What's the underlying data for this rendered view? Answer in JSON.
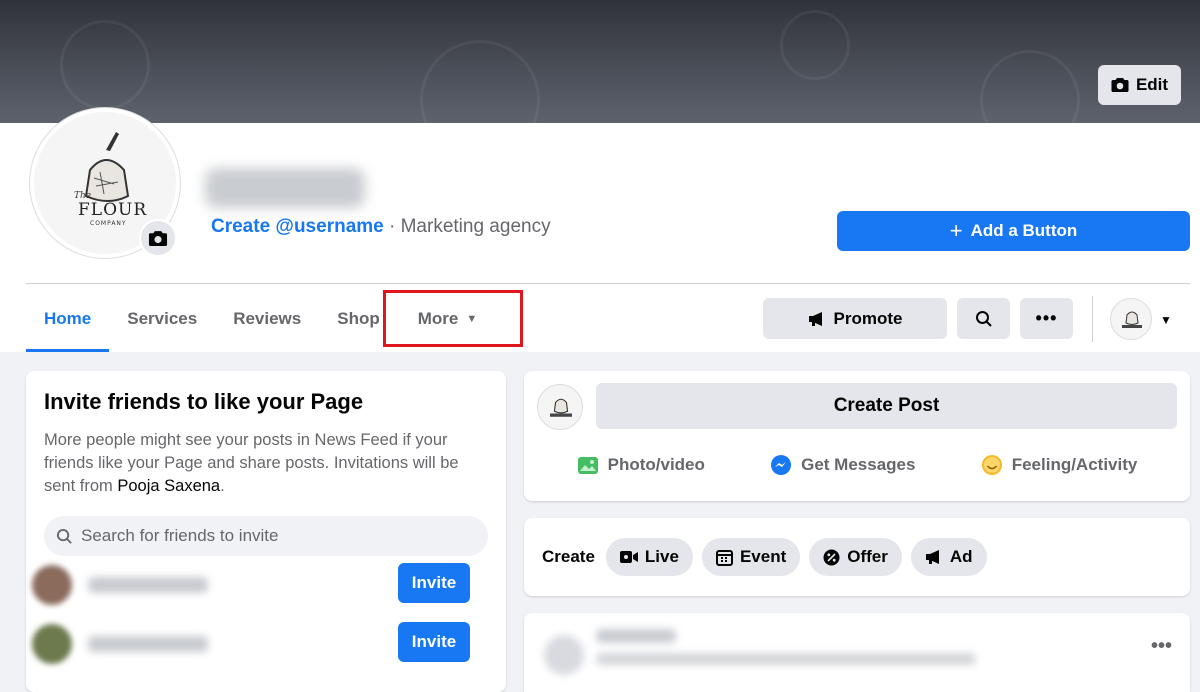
{
  "cover": {
    "edit_label": "Edit"
  },
  "page": {
    "logo_text": "FLOUR",
    "logo_prefix": "The",
    "logo_sub": "COMPANY",
    "username_link": "Create @username",
    "separator": "·",
    "category": "Marketing agency",
    "add_button": "Add a Button"
  },
  "tabs": [
    {
      "label": "Home",
      "active": true
    },
    {
      "label": "Services"
    },
    {
      "label": "Reviews"
    },
    {
      "label": "Shop"
    },
    {
      "label": "More"
    }
  ],
  "toolbar": {
    "promote": "Promote"
  },
  "invite": {
    "title": "Invite friends to like your Page",
    "description": "More people might see your posts in News Feed if your friends like your Page and share posts. Invitations will be sent from ",
    "sender": "Pooja Saxena",
    "end": ".",
    "search_placeholder": "Search for friends to invite",
    "invite_label": "Invite"
  },
  "composer": {
    "create_post": "Create Post",
    "actions": [
      "Photo/video",
      "Get Messages",
      "Feeling/Activity"
    ]
  },
  "create_bar": {
    "label": "Create",
    "pills": [
      "Live",
      "Event",
      "Offer",
      "Ad"
    ]
  },
  "colors": {
    "brand_blue": "#1877f2",
    "highlight_red": "#e0161e"
  }
}
